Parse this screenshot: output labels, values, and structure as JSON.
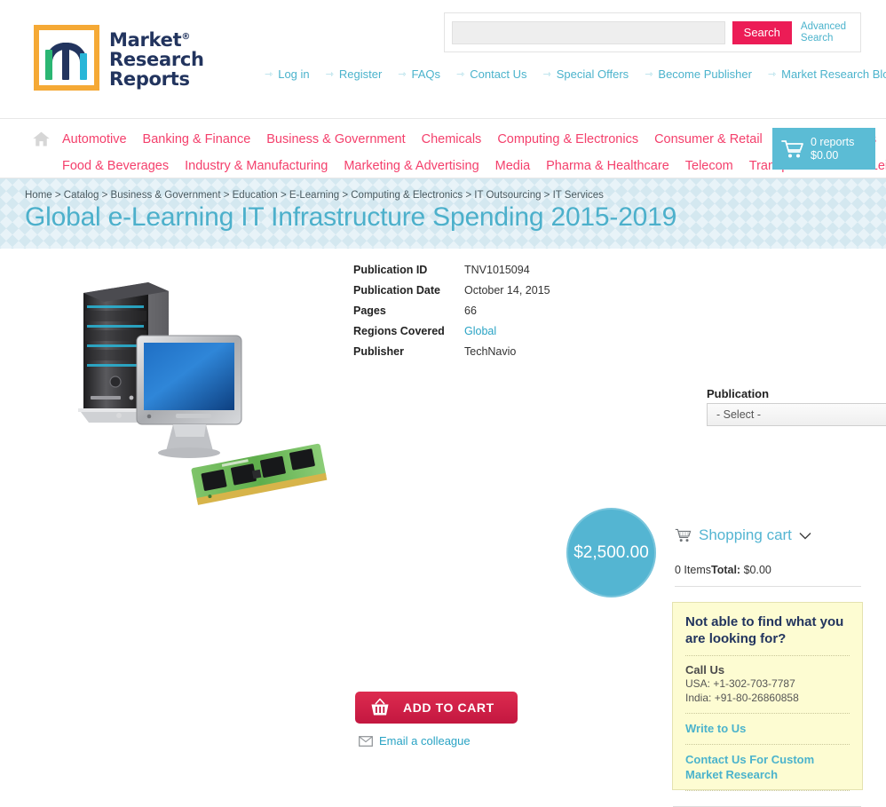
{
  "brand": {
    "name_lines": [
      "Market",
      "Research",
      "Reports"
    ],
    "registered_mark": "®",
    "logo_icon": "m-lettermark-logo"
  },
  "search": {
    "value": "",
    "placeholder": "",
    "button_label": "Search",
    "advanced_label": "Advanced Search"
  },
  "top_links": [
    {
      "label": "Log in"
    },
    {
      "label": "Register"
    },
    {
      "label": "FAQs"
    },
    {
      "label": "Contact Us"
    },
    {
      "label": "Special Offers"
    },
    {
      "label": "Become Publisher"
    },
    {
      "label": "Market Research Blog"
    }
  ],
  "categories_row1": [
    {
      "label": "Automotive"
    },
    {
      "label": "Banking & Finance"
    },
    {
      "label": "Business & Government"
    },
    {
      "label": "Chemicals"
    },
    {
      "label": "Computing & Electronics"
    },
    {
      "label": "Consumer & Retail"
    },
    {
      "label": "Energy & Utilities"
    }
  ],
  "categories_row2": [
    {
      "label": "Food & Beverages"
    },
    {
      "label": "Industry & Manufacturing"
    },
    {
      "label": "Marketing & Advertising"
    },
    {
      "label": "Media"
    },
    {
      "label": "Pharma & Healthcare"
    },
    {
      "label": "Telecom"
    },
    {
      "label": "Transport"
    },
    {
      "label": "Travel & Leisure"
    }
  ],
  "cart_widget": {
    "reports": "0 reports",
    "amount": "$0.00"
  },
  "banner": {
    "breadcrumb": "Home > Catalog > Business & Government > Education > E-Learning > Computing & Electronics > IT Outsourcing > IT Services",
    "title": "Global e-Learning IT Infrastructure Spending 2015-2019"
  },
  "details": [
    {
      "label": "Publication ID",
      "value": "TNV1015094",
      "is_link": false
    },
    {
      "label": "Publication Date",
      "value": "October 14, 2015",
      "is_link": false
    },
    {
      "label": "Pages",
      "value": "66",
      "is_link": false
    },
    {
      "label": "Regions Covered",
      "value": "Global",
      "is_link": true
    },
    {
      "label": "Publisher",
      "value": "TechNavio",
      "is_link": false
    }
  ],
  "price": {
    "amount": "$2,500.00"
  },
  "publication_type": {
    "label": "Publication Type",
    "required_marker": "*",
    "selected": "- Select -",
    "options": [
      "- Select -"
    ]
  },
  "add_to_cart": {
    "label": "ADD TO CART",
    "icon": "shopping-basket-icon"
  },
  "email_colleague": {
    "label": "Email a colleague",
    "icon": "envelope-icon"
  },
  "shopping_cart_panel": {
    "title": "Shopping cart",
    "items_text": "0 Items",
    "total_label": "Total:",
    "total_value": "$0.00"
  },
  "help_box": {
    "title": "Not able to find what you are looking for?",
    "call_us_label": "Call Us",
    "phone_usa": "USA: +1-302-703-7787",
    "phone_india": "India: +91-80-26860858",
    "write_link": "Write to Us",
    "custom_link": "Contact Us For Custom Market Research"
  },
  "colors": {
    "accent_teal": "#54b5d2",
    "accent_pink": "#f4406c",
    "search_button": "#ec1c56",
    "add_to_cart": "#c31740",
    "logo_orange": "#f5a935",
    "logo_navy": "#22345e",
    "help_box_bg": "#fdfcd2",
    "banner_bg": "#e8f3f8"
  }
}
